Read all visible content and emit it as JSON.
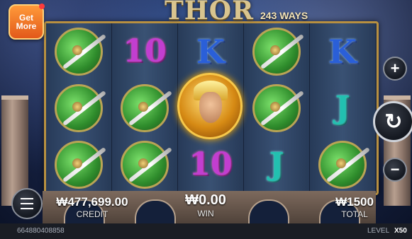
{
  "game": {
    "logo": "THOR",
    "ways": "243 WAYS"
  },
  "promo": {
    "line1": "Get",
    "line2": "More"
  },
  "reels": [
    [
      "shield-sword",
      "shield-sword",
      "shield-sword"
    ],
    [
      "ten",
      "shield-sword",
      "shield-sword"
    ],
    [
      "king",
      "thor-wild",
      "ten"
    ],
    [
      "shield-sword",
      "shield-sword",
      "jack"
    ],
    [
      "king",
      "jack",
      "shield-sword"
    ]
  ],
  "symbols": {
    "ten": "10",
    "king": "K",
    "jack": "J"
  },
  "hud": {
    "credit_value": "₩477,699.00",
    "credit_label": "CREDIT",
    "win_value": "₩0.00",
    "win_label": "WIN",
    "total_value": "₩1500",
    "total_label": "TOTAL"
  },
  "controls": {
    "plus": "+",
    "minus": "−",
    "spin": "↻"
  },
  "status": {
    "session_id": "664880408858",
    "level_label": "LEVEL",
    "level_value": "X50"
  }
}
